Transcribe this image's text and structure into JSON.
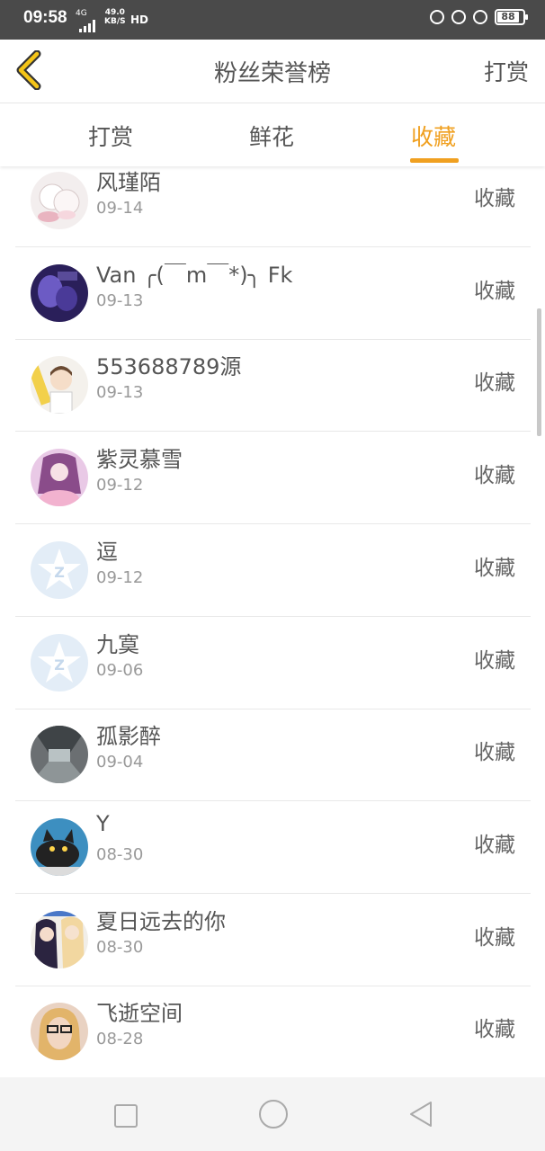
{
  "status_bar": {
    "time": "09:58",
    "network": "4G",
    "speed_value": "49.0",
    "speed_unit": "KB/S",
    "hd_label": "HD",
    "battery": "88"
  },
  "header": {
    "back_icon": "chevron-left-icon",
    "title": "粉丝荣誉榜",
    "action_label": "打赏"
  },
  "tabs": [
    {
      "label": "打赏",
      "active": false
    },
    {
      "label": "鲜花",
      "active": false
    },
    {
      "label": "收藏",
      "active": true
    }
  ],
  "colors": {
    "accent": "#f0a020",
    "status_bar": "#4a4a4a",
    "text": "#555555",
    "subtext": "#999999"
  },
  "fans": [
    {
      "name": "风瑾陌",
      "date": "09-14",
      "action": "收藏"
    },
    {
      "name": "Van ╭(￣m￣*)╮ Fk",
      "date": "09-13",
      "action": "收藏"
    },
    {
      "name": "553688789源",
      "date": "09-13",
      "action": "收藏"
    },
    {
      "name": "紫灵慕雪",
      "date": "09-12",
      "action": "收藏"
    },
    {
      "name": "逗",
      "date": "09-12",
      "action": "收藏"
    },
    {
      "name": "九寞",
      "date": "09-06",
      "action": "收藏"
    },
    {
      "name": "孤影醉",
      "date": "09-04",
      "action": "收藏"
    },
    {
      "name": "Y",
      "date": "08-30",
      "action": "收藏"
    },
    {
      "name": "夏日远去的你",
      "date": "08-30",
      "action": "收藏"
    },
    {
      "name": "飞逝空间",
      "date": "08-28",
      "action": "收藏"
    }
  ],
  "nav": {
    "recent_icon": "square-icon",
    "home_icon": "circle-icon",
    "back_icon": "triangle-back-icon"
  }
}
